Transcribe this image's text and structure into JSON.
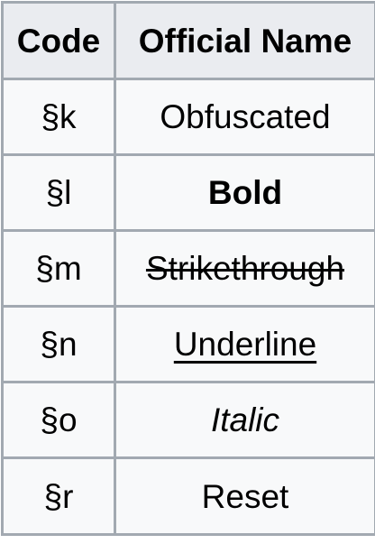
{
  "table": {
    "headers": [
      "Code",
      "Official Name"
    ],
    "rows": [
      {
        "code": "§k",
        "name": "Obfuscated",
        "style": "plain"
      },
      {
        "code": "§l",
        "name": "Bold",
        "style": "bold"
      },
      {
        "code": "§m",
        "name": "Strikethrough",
        "style": "strikethrough"
      },
      {
        "code": "§n",
        "name": "Underline",
        "style": "underline"
      },
      {
        "code": "§o",
        "name": "Italic",
        "style": "italic"
      },
      {
        "code": "§r",
        "name": "Reset",
        "style": "plain"
      }
    ]
  }
}
